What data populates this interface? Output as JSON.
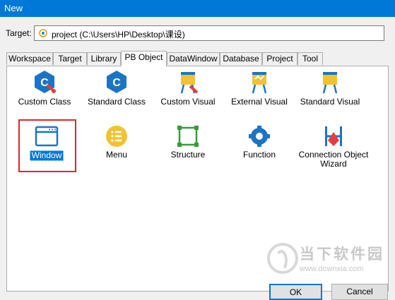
{
  "window": {
    "title": "New"
  },
  "target": {
    "label": "Target:",
    "value": "project (C:\\Users\\HP\\Desktop\\课设)"
  },
  "tabs": [
    {
      "label": "Workspace"
    },
    {
      "label": "Target"
    },
    {
      "label": "Library"
    },
    {
      "label": "PB Object",
      "active": true
    },
    {
      "label": "DataWindow"
    },
    {
      "label": "Database"
    },
    {
      "label": "Project"
    },
    {
      "label": "Tool"
    }
  ],
  "items": [
    {
      "label": "Custom Class",
      "icon": "custom-class-icon"
    },
    {
      "label": "Standard Class",
      "icon": "standard-class-icon"
    },
    {
      "label": "Custom Visual",
      "icon": "custom-visual-icon"
    },
    {
      "label": "External Visual",
      "icon": "external-visual-icon"
    },
    {
      "label": "Standard Visual",
      "icon": "standard-visual-icon"
    },
    {
      "label": "Window",
      "icon": "window-icon",
      "selected": true
    },
    {
      "label": "Menu",
      "icon": "menu-icon"
    },
    {
      "label": "Structure",
      "icon": "structure-icon"
    },
    {
      "label": "Function",
      "icon": "function-icon"
    },
    {
      "label": "Connection Object",
      "label2": "Wizard",
      "icon": "connection-object-wizard-icon"
    }
  ],
  "buttons": {
    "ok": "OK",
    "cancel": "Cancel"
  },
  "watermark": {
    "name": "当下软件园",
    "url": "www.downxia.com"
  },
  "colors": {
    "titlebar": "#0078d7",
    "selection": "#0078d7",
    "highlight_box": "#e0242c",
    "icon_blue": "#1c74c4",
    "icon_yellow": "#f2c230",
    "icon_green": "#3a9a3a"
  }
}
